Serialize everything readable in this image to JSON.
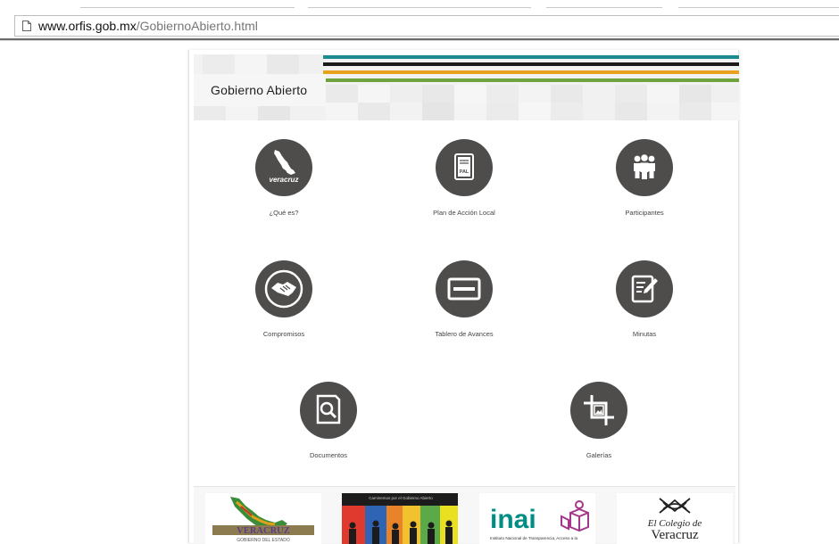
{
  "browser": {
    "url_host": "www.orfis.gob.mx",
    "url_path": "/GobiernoAbierto.html"
  },
  "header": {
    "title": "Gobierno Abierto",
    "stripe_colors": [
      "#1c8a8e",
      "#1a1a1a",
      "#e8a21d",
      "#6ea33d"
    ]
  },
  "nav": {
    "items": [
      {
        "label": "¿Qué es?",
        "icon": "veracruz-map-icon"
      },
      {
        "label": "Plan de Acción Local",
        "icon": "pal-document-icon"
      },
      {
        "label": "Participantes",
        "icon": "people-icon"
      },
      {
        "label": "Compromisos",
        "icon": "handshake-icon"
      },
      {
        "label": "Tablero de Avances",
        "icon": "dashboard-board-icon"
      },
      {
        "label": "Minutas",
        "icon": "edit-notes-icon"
      },
      {
        "label": "Documentos",
        "icon": "document-search-icon"
      },
      {
        "label": "Galerías",
        "icon": "crop-image-icon"
      }
    ],
    "map_icon_text": "veracruz",
    "pal_icon_text": "PAL"
  },
  "logos": {
    "veracruz_name": "VERACRUZ",
    "veracruz_sub": "GOBIERNO DEL ESTADO",
    "poster_text": "Caminemos por el Gobierno Abierto",
    "inai_name": "inai",
    "inai_sub": "Instituto Nacional de Transparencia, Acceso a la",
    "colegio_top": "El Colegio de",
    "colegio_bottom": "Veracruz"
  },
  "colors": {
    "icon_circle": "#4f4c4c",
    "inai_purple": "#a4378b",
    "inai_teal": "#008e84",
    "veracruz_green": "#3c8d3a"
  }
}
